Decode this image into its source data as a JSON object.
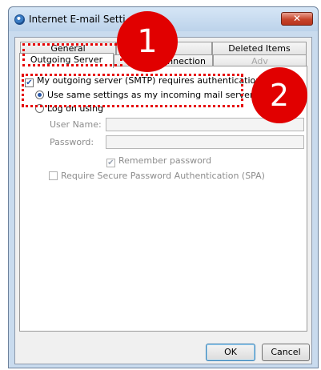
{
  "window": {
    "title": "Internet E-mail Setti",
    "close_glyph": "✕"
  },
  "tabs": {
    "row_back": [
      "General",
      "",
      "Deleted Items"
    ],
    "row_front": [
      "Outgoing Server",
      "nnection",
      "Adv"
    ]
  },
  "auth": {
    "requires_auth_label": "My outgoing server (SMTP) requires authentication",
    "requires_auth_checked": true,
    "use_same_label": "Use same settings as my incoming mail server",
    "log_on_label": "Log on using",
    "user_name_label": "User Name:",
    "user_name_value": "",
    "password_label": "Password:",
    "password_value": "",
    "remember_label": "Remember password",
    "remember_checked": true,
    "spa_label": "Require Secure Password Authentication (SPA)",
    "spa_checked": false
  },
  "buttons": {
    "ok": "OK",
    "cancel": "Cancel"
  },
  "annotations": {
    "badge1": "1",
    "badge2": "2",
    "color": "#e10000"
  }
}
